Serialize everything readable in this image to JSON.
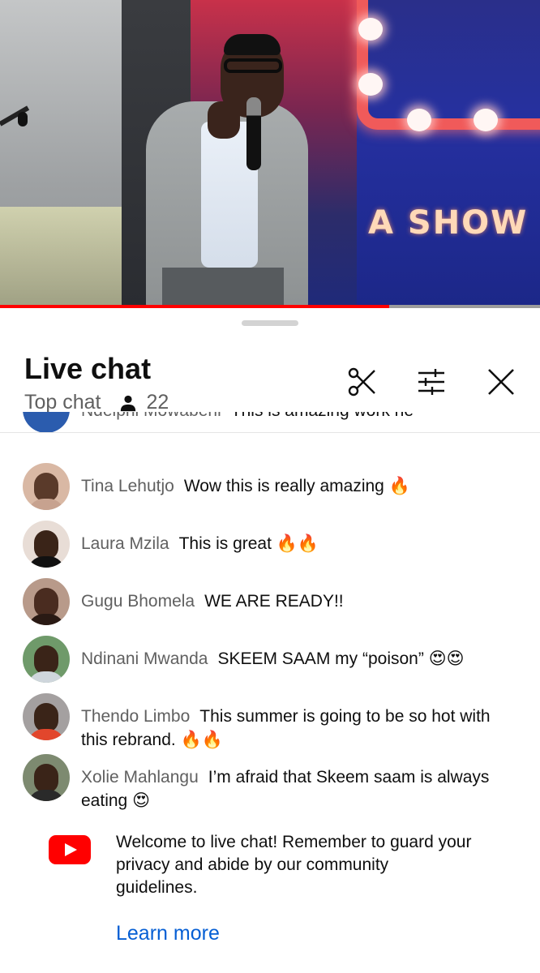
{
  "video": {
    "banner_text": "A SHOW",
    "progress_percent": 72
  },
  "chat": {
    "title": "Live chat",
    "mode": "Top chat",
    "viewer_count": "22",
    "icons": [
      "scissors-icon",
      "filter-sliders-icon",
      "close-icon"
    ],
    "partial_message": {
      "author": "Ndeiphi Mowabeni",
      "text": "This is amazing work ne"
    },
    "messages": [
      {
        "author": "Tina Lehutjo",
        "text": "Wow this is really amazing",
        "emoji": "🔥"
      },
      {
        "author": "Laura Mzila",
        "text": "This is great",
        "emoji": "🔥🔥"
      },
      {
        "author": "Gugu Bhomela",
        "text": "WE ARE READY!!",
        "emoji": ""
      },
      {
        "author": "Ndinani Mwanda",
        "text": "SKEEM SAAM my “poison”",
        "emoji": "😍😍"
      },
      {
        "author": "Thendo Limbo",
        "text": "This summer is going to be so hot with this rebrand.",
        "emoji": "🔥🔥"
      },
      {
        "author": "Xolie Mahlangu",
        "text": "I’m afraid that Skeem saam is always eating",
        "emoji": "😍"
      }
    ],
    "welcome_text": "Welcome to live chat! Remember to guard your privacy and abide by our community guidelines.",
    "learn_more": "Learn more"
  },
  "colors": {
    "progress_red": "#ff0000",
    "link_blue": "#065fd4",
    "author_gray": "#606060"
  }
}
